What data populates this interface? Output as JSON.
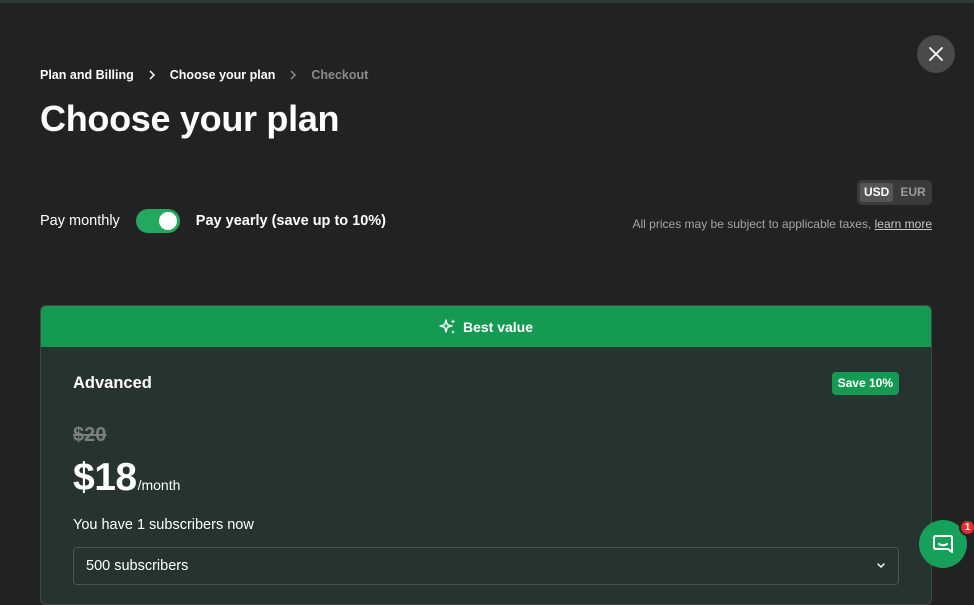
{
  "colors": {
    "background": "#222222",
    "accent_green": "#159a53",
    "card_background": "#27332f",
    "badge_red": "#e52b2b"
  },
  "breadcrumb": {
    "items": [
      "Plan and Billing",
      "Choose your plan",
      "Checkout"
    ],
    "separator_icon": "chevron-right-icon"
  },
  "header": {
    "title": "Choose your plan",
    "close_icon": "close-icon"
  },
  "billing": {
    "monthly_label": "Pay monthly",
    "yearly_label": "Pay yearly (save up to 10%)",
    "yearly_selected": true
  },
  "currency": {
    "options": [
      "USD",
      "EUR"
    ],
    "selected": "USD"
  },
  "tax_note": {
    "text": "All prices may be subject to applicable taxes, ",
    "link": "learn more"
  },
  "plan": {
    "banner_icon": "sparkles-icon",
    "banner_label": "Best value",
    "name": "Advanced",
    "badge": "Save 10%",
    "old_price": "$20",
    "price": "$18",
    "period": "/month",
    "subscribers_note": "You have 1 subscribers now",
    "subscribers_select": {
      "value": "500 subscribers",
      "icon": "chevron-down-icon"
    }
  },
  "chat": {
    "icon": "chat-icon",
    "badge_count": "1"
  }
}
